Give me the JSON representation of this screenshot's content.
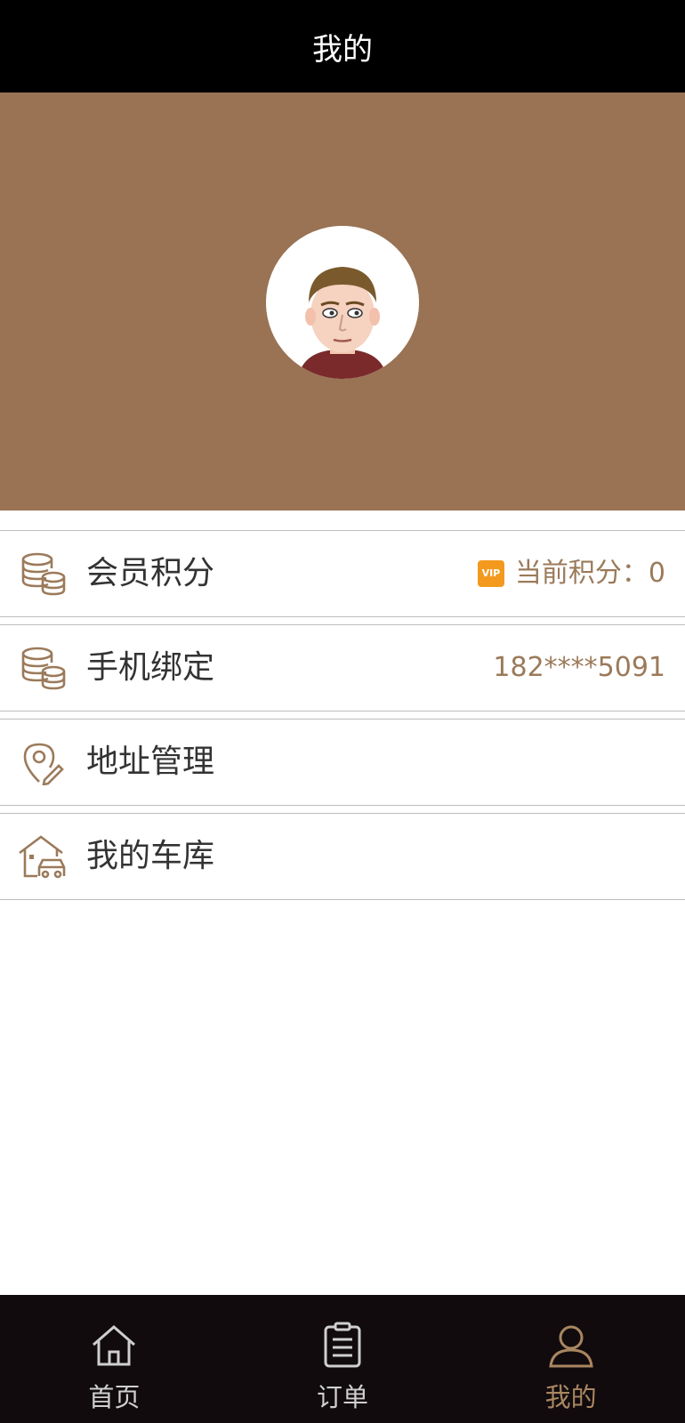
{
  "header": {
    "title": "我的"
  },
  "profile": {
    "avatar_icon": "user-avatar",
    "banner_color": "#997354"
  },
  "menu": {
    "items": [
      {
        "label": "会员积分",
        "icon": "coins-icon",
        "right_badge": "VIP",
        "right_text": "当前积分：0"
      },
      {
        "label": "手机绑定",
        "icon": "coins-icon",
        "right_text": "182****5091"
      },
      {
        "label": "地址管理",
        "icon": "location-edit-icon"
      },
      {
        "label": "我的车库",
        "icon": "garage-icon"
      }
    ]
  },
  "tabbar": {
    "items": [
      {
        "label": "首页",
        "icon": "home-icon"
      },
      {
        "label": "订单",
        "icon": "order-list-icon"
      },
      {
        "label": "我的",
        "icon": "user-icon"
      }
    ],
    "active_color": "#a98660",
    "inactive_color": "#cfcfcf"
  }
}
